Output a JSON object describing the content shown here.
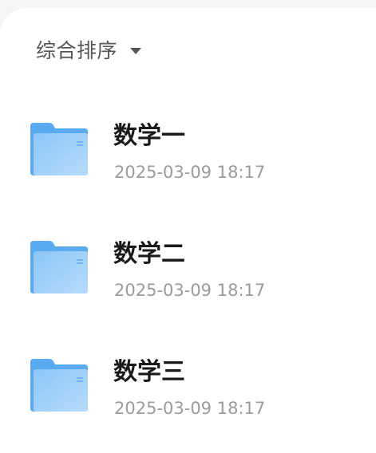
{
  "sort": {
    "label": "综合排序",
    "caret_icon": "caret-down-icon"
  },
  "files": [
    {
      "name": "数学一",
      "time": "2025-03-09 18:17",
      "icon": "folder-icon"
    },
    {
      "name": "数学二",
      "time": "2025-03-09 18:17",
      "icon": "folder-icon"
    },
    {
      "name": "数学三",
      "time": "2025-03-09 18:17",
      "icon": "folder-icon"
    }
  ],
  "colors": {
    "folder_back": "#5aaaf0",
    "folder_front_top": "#8cc6f7",
    "folder_front_bottom": "#b6dcfb",
    "text_primary": "#1a1a1a",
    "text_secondary": "#9b9b9b",
    "sort_text": "#555555"
  }
}
